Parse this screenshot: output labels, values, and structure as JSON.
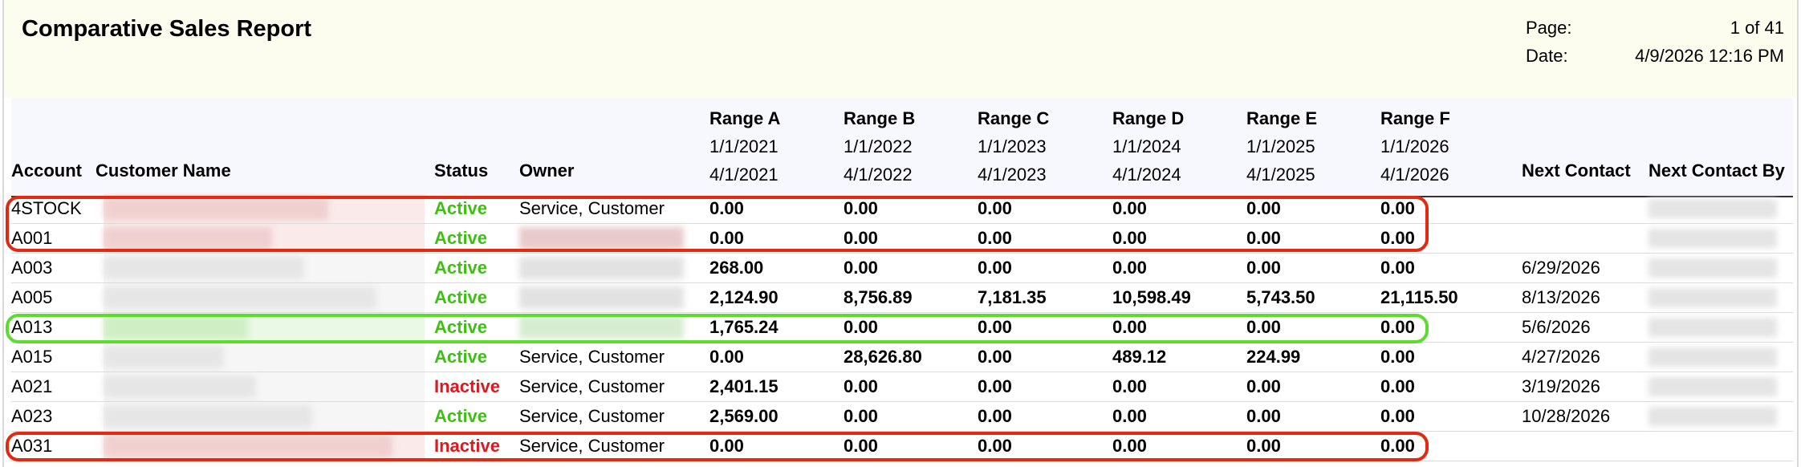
{
  "report": {
    "title": "Comparative Sales Report",
    "page_label": "Page:",
    "page_value": "1 of 41",
    "date_label": "Date:",
    "date_value": "4/9/2026 12:16 PM"
  },
  "columns": {
    "account": "Account",
    "customer_name": "Customer Name",
    "status": "Status",
    "owner": "Owner",
    "next_contact": "Next Contact",
    "next_contact_by": "Next Contact By"
  },
  "ranges": [
    {
      "name": "Range A",
      "start": "1/1/2021",
      "end": "4/1/2021"
    },
    {
      "name": "Range B",
      "start": "1/1/2022",
      "end": "4/1/2022"
    },
    {
      "name": "Range C",
      "start": "1/1/2023",
      "end": "4/1/2023"
    },
    {
      "name": "Range D",
      "start": "1/1/2024",
      "end": "4/1/2024"
    },
    {
      "name": "Range E",
      "start": "1/1/2025",
      "end": "4/1/2025"
    },
    {
      "name": "Range F",
      "start": "1/1/2026",
      "end": "4/1/2026"
    }
  ],
  "rows": [
    {
      "account": "4STOCK",
      "status": "Active",
      "owner": "Service, Customer",
      "values": [
        "0.00",
        "0.00",
        "0.00",
        "0.00",
        "0.00",
        "0.00"
      ],
      "next_contact": ""
    },
    {
      "account": "A001",
      "status": "Active",
      "owner": "",
      "values": [
        "0.00",
        "0.00",
        "0.00",
        "0.00",
        "0.00",
        "0.00"
      ],
      "next_contact": ""
    },
    {
      "account": "A003",
      "status": "Active",
      "owner": "",
      "values": [
        "268.00",
        "0.00",
        "0.00",
        "0.00",
        "0.00",
        "0.00"
      ],
      "next_contact": "6/29/2026"
    },
    {
      "account": "A005",
      "status": "Active",
      "owner": "",
      "values": [
        "2,124.90",
        "8,756.89",
        "7,181.35",
        "10,598.49",
        "5,743.50",
        "21,115.50"
      ],
      "next_contact": "8/13/2026"
    },
    {
      "account": "A013",
      "status": "Active",
      "owner": "",
      "values": [
        "1,765.24",
        "0.00",
        "0.00",
        "0.00",
        "0.00",
        "0.00"
      ],
      "next_contact": "5/6/2026"
    },
    {
      "account": "A015",
      "status": "Active",
      "owner": "Service, Customer",
      "values": [
        "0.00",
        "28,626.80",
        "0.00",
        "489.12",
        "224.99",
        "0.00"
      ],
      "next_contact": "4/27/2026"
    },
    {
      "account": "A021",
      "status": "Inactive",
      "owner": "Service, Customer",
      "values": [
        "2,401.15",
        "0.00",
        "0.00",
        "0.00",
        "0.00",
        "0.00"
      ],
      "next_contact": "3/19/2026"
    },
    {
      "account": "A023",
      "status": "Active",
      "owner": "Service, Customer",
      "values": [
        "2,569.00",
        "0.00",
        "0.00",
        "0.00",
        "0.00",
        "0.00"
      ],
      "next_contact": "10/28/2026"
    },
    {
      "account": "A031",
      "status": "Inactive",
      "owner": "Service, Customer",
      "values": [
        "0.00",
        "0.00",
        "0.00",
        "0.00",
        "0.00",
        "0.00"
      ],
      "next_contact": ""
    }
  ],
  "colors": {
    "active": "#3fbf14",
    "inactive": "#e0181e",
    "highlight_red": "#e22a12",
    "highlight_green": "#5cdc2e",
    "header_bg": "#fcfdee"
  }
}
